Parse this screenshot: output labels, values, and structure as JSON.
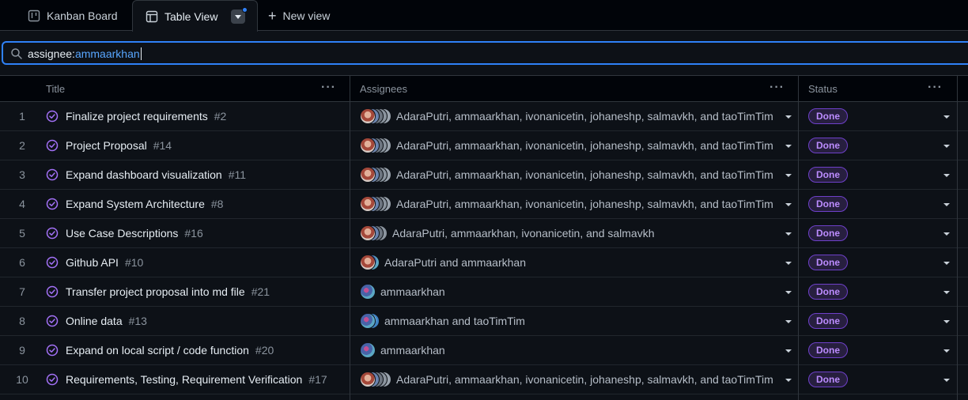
{
  "tabs": {
    "kanban": "Kanban Board",
    "table": "Table View",
    "new_view": "New view"
  },
  "filter": {
    "key": "assignee:",
    "value": "ammaarkhan"
  },
  "columns": {
    "title": "Title",
    "assignees": "Assignees",
    "status": "Status"
  },
  "rows": [
    {
      "index": "1",
      "title": "Finalize project requirements",
      "number": "#2",
      "assignees": "AdaraPutri, ammaarkhan, ivonanicetin, johaneshp, salmavkh, and taoTimTim",
      "status": "Done"
    },
    {
      "index": "2",
      "title": "Project Proposal",
      "number": "#14",
      "assignees": "AdaraPutri, ammaarkhan, ivonanicetin, johaneshp, salmavkh, and taoTimTim",
      "status": "Done"
    },
    {
      "index": "3",
      "title": "Expand dashboard visualization",
      "number": "#11",
      "assignees": "AdaraPutri, ammaarkhan, ivonanicetin, johaneshp, salmavkh, and taoTimTim",
      "status": "Done"
    },
    {
      "index": "4",
      "title": "Expand System Architecture",
      "number": "#8",
      "assignees": "AdaraPutri, ammaarkhan, ivonanicetin, johaneshp, salmavkh, and taoTimTim",
      "status": "Done"
    },
    {
      "index": "5",
      "title": "Use Case Descriptions",
      "number": "#16",
      "assignees": "AdaraPutri, ammaarkhan, ivonanicetin, and salmavkh",
      "status": "Done"
    },
    {
      "index": "6",
      "title": "Github API",
      "number": "#10",
      "assignees": "AdaraPutri and ammaarkhan",
      "status": "Done"
    },
    {
      "index": "7",
      "title": "Transfer project proposal into md file",
      "number": "#21",
      "assignees": "ammaarkhan",
      "status": "Done"
    },
    {
      "index": "8",
      "title": "Online data",
      "number": "#13",
      "assignees": "ammaarkhan and taoTimTim",
      "status": "Done"
    },
    {
      "index": "9",
      "title": "Expand on local script / code function",
      "number": "#20",
      "assignees": "ammaarkhan",
      "status": "Done"
    },
    {
      "index": "10",
      "title": "Requirements, Testing, Requirement Verification",
      "number": "#17",
      "assignees": "AdaraPutri, ammaarkhan, ivonanicetin, johaneshp, salmavkh, and taoTimTim",
      "status": "Done"
    }
  ],
  "colors": {
    "accent": "#2f81f7",
    "done_badge": "#bc8cff",
    "issue_closed": "#a371f7"
  }
}
